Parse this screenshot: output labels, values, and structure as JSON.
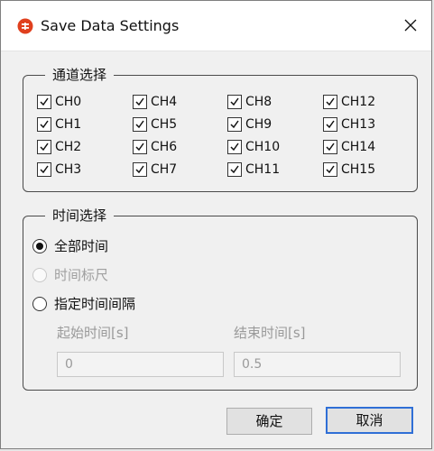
{
  "window": {
    "title": "Save Data Settings",
    "accent_color": "#e0401e"
  },
  "channels_group": {
    "title": "通道选择",
    "items": [
      {
        "label": "CH0",
        "checked": true
      },
      {
        "label": "CH4",
        "checked": true
      },
      {
        "label": "CH8",
        "checked": true
      },
      {
        "label": "CH12",
        "checked": true
      },
      {
        "label": "CH1",
        "checked": true
      },
      {
        "label": "CH5",
        "checked": true
      },
      {
        "label": "CH9",
        "checked": true
      },
      {
        "label": "CH13",
        "checked": true
      },
      {
        "label": "CH2",
        "checked": true
      },
      {
        "label": "CH6",
        "checked": true
      },
      {
        "label": "CH10",
        "checked": true
      },
      {
        "label": "CH14",
        "checked": true
      },
      {
        "label": "CH3",
        "checked": true
      },
      {
        "label": "CH7",
        "checked": true
      },
      {
        "label": "CH11",
        "checked": true
      },
      {
        "label": "CH15",
        "checked": true
      }
    ]
  },
  "time_group": {
    "title": "时间选择",
    "options": [
      {
        "label": "全部时间",
        "checked": true,
        "disabled": false
      },
      {
        "label": "时间标尺",
        "checked": false,
        "disabled": true
      },
      {
        "label": "指定时间间隔",
        "checked": false,
        "disabled": false
      }
    ],
    "start_label": "起始时间[s]",
    "start_value": "0",
    "end_label": "结束时间[s]",
    "end_value": "0.5"
  },
  "buttons": {
    "ok_label": "确定",
    "cancel_label": "取消"
  }
}
